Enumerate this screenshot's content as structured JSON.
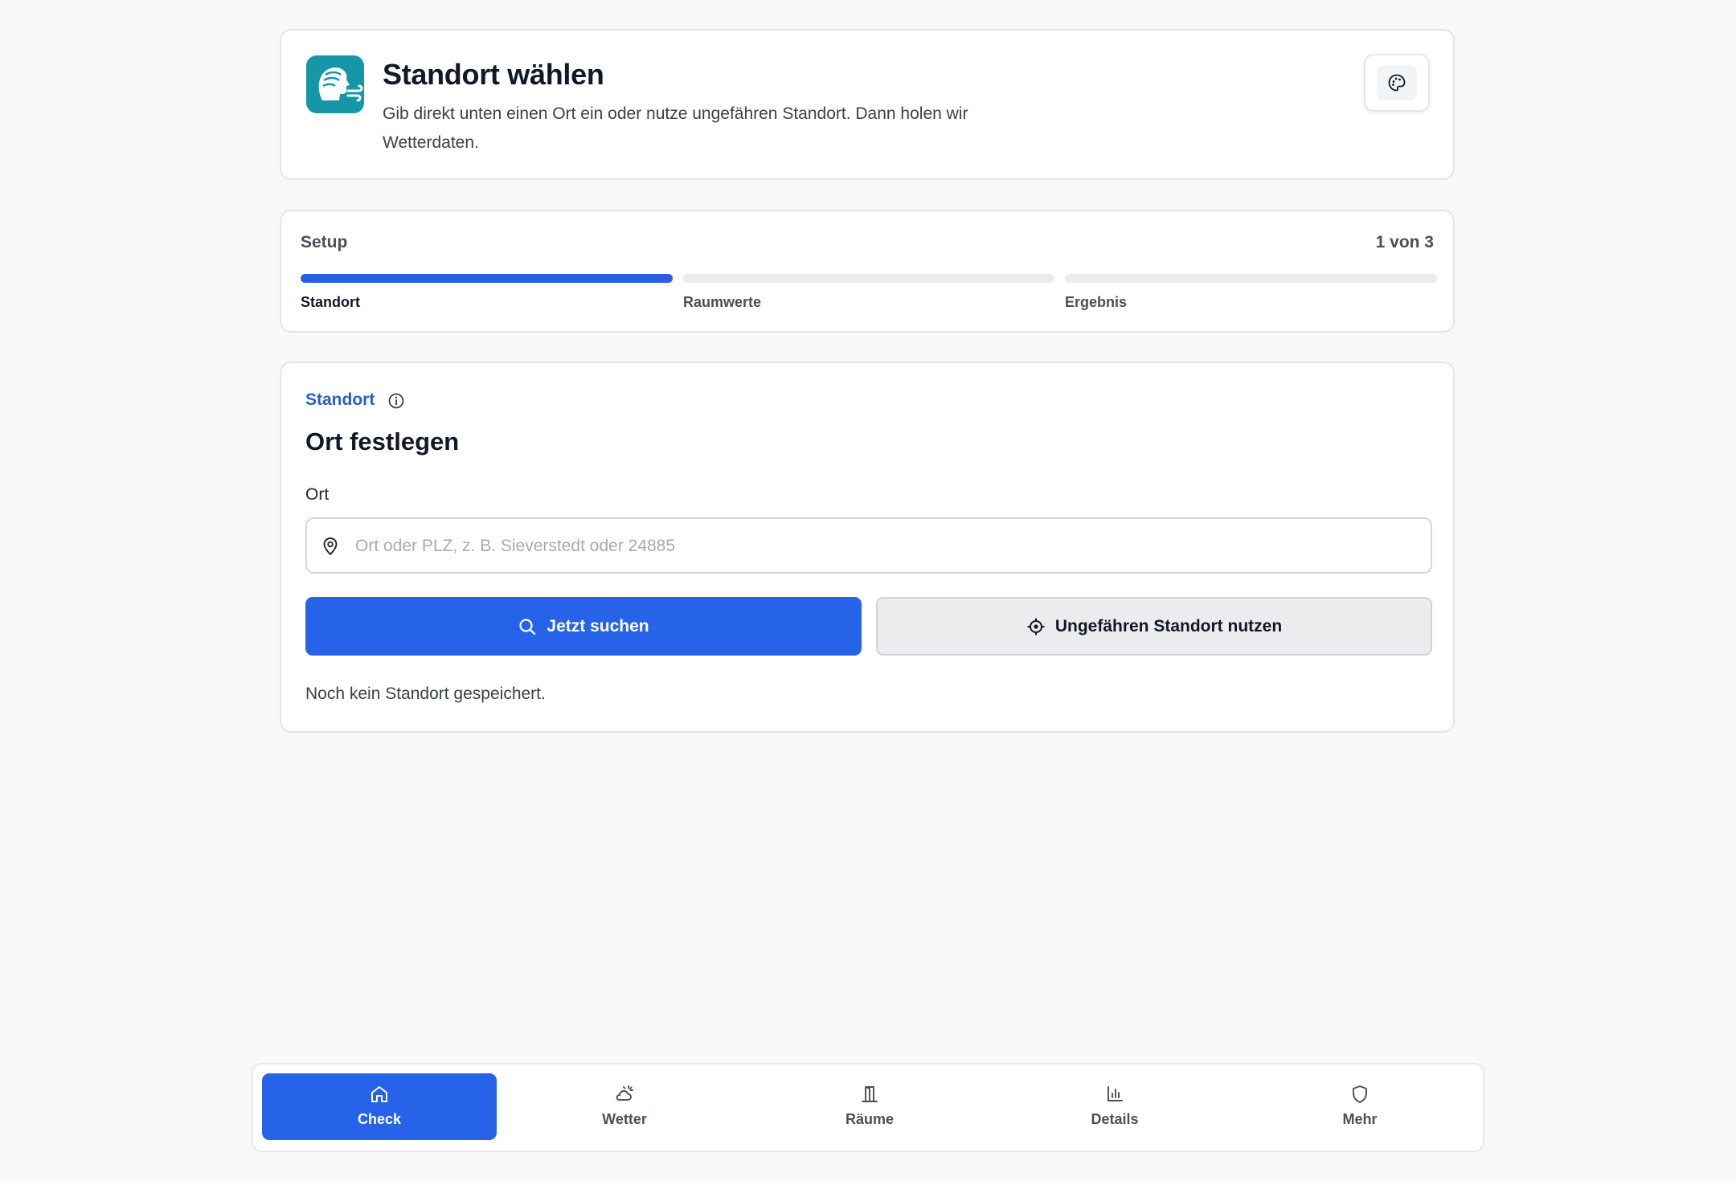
{
  "header": {
    "title": "Standort wählen",
    "description": "Gib direkt unten einen Ort ein oder nutze ungefähren Standort. Dann holen wir Wetterdaten.",
    "theme_button_icon": "palette-icon",
    "logo_icon": "wind-face-icon"
  },
  "setup": {
    "label": "Setup",
    "progress_text": "1 von 3",
    "current_step": 1,
    "steps": [
      {
        "label": "Standort"
      },
      {
        "label": "Raumwerte"
      },
      {
        "label": "Ergebnis"
      }
    ]
  },
  "location": {
    "section_label": "Standort",
    "title": "Ort festlegen",
    "field_label": "Ort",
    "input_value": "",
    "input_placeholder": "Ort oder PLZ, z. B. Sieverstedt oder 24885",
    "search_button": "Jetzt suchen",
    "locate_button": "Ungefähren Standort nutzen",
    "status": "Noch kein Standort gespeichert."
  },
  "nav": {
    "items": [
      {
        "label": "Check",
        "icon": "home-icon",
        "active": true
      },
      {
        "label": "Wetter",
        "icon": "weather-icon",
        "active": false
      },
      {
        "label": "Räume",
        "icon": "door-icon",
        "active": false
      },
      {
        "label": "Details",
        "icon": "bar-chart-icon",
        "active": false
      },
      {
        "label": "Mehr",
        "icon": "shield-icon",
        "active": false
      }
    ]
  },
  "colors": {
    "accent": "#2663e8",
    "logo_bg": "#1597a8",
    "section_label": "#2a5ec8",
    "background": "#f9f9fa"
  }
}
